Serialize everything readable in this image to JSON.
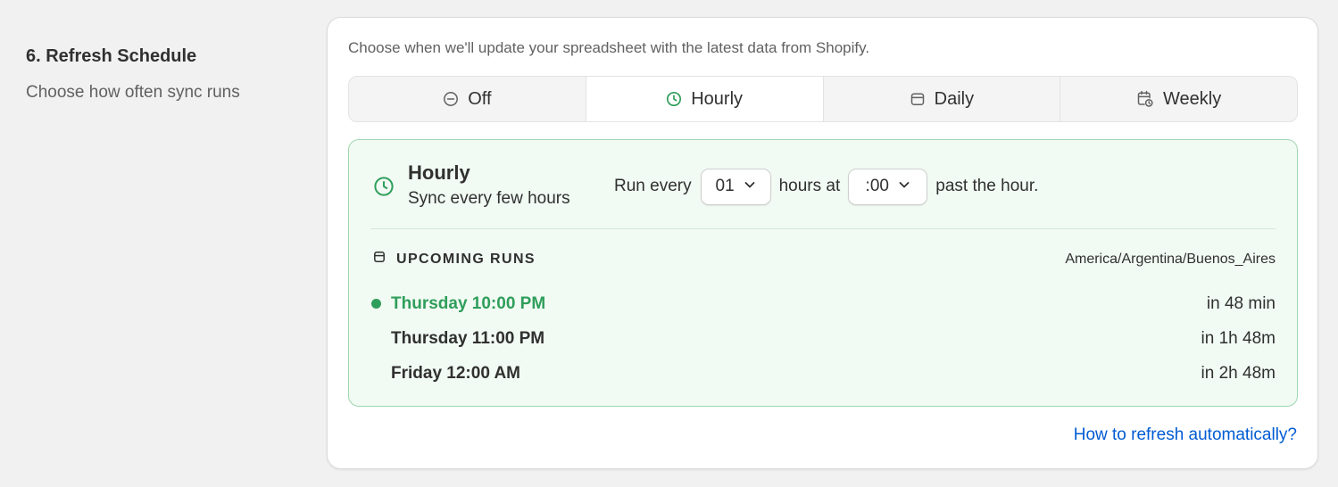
{
  "section": {
    "title": "6. Refresh Schedule",
    "description": "Choose how often sync runs"
  },
  "card": {
    "description": "Choose when we'll update your spreadsheet with the latest data from Shopify.",
    "options": [
      {
        "label": "Off",
        "icon": "minus-circle-icon"
      },
      {
        "label": "Hourly",
        "icon": "clock-icon",
        "selected": true
      },
      {
        "label": "Daily",
        "icon": "calendar-icon"
      },
      {
        "label": "Weekly",
        "icon": "calendar-clock-icon"
      }
    ],
    "help_link": "How to refresh automatically?"
  },
  "panel": {
    "title": "Hourly",
    "subtitle": "Sync every few hours",
    "run_every": "Run every",
    "hours_value": "01",
    "hours_at": "hours at",
    "minute_value": ":00",
    "past_hour": "past the hour.",
    "upcoming_label": "UPCOMING RUNS",
    "timezone": "America/Argentina/Buenos_Aires",
    "runs": [
      {
        "when": "Thursday 10:00 PM",
        "relative": "in 48 min",
        "next": true
      },
      {
        "when": "Thursday 11:00 PM",
        "relative": "in 1h 48m"
      },
      {
        "when": "Friday 12:00 AM",
        "relative": "in 2h 48m"
      }
    ]
  },
  "colors": {
    "accent_green": "#2f9e5b",
    "panel_bg": "#f1faf3",
    "panel_border": "#9fd7b0",
    "link_blue": "#005bd3"
  }
}
